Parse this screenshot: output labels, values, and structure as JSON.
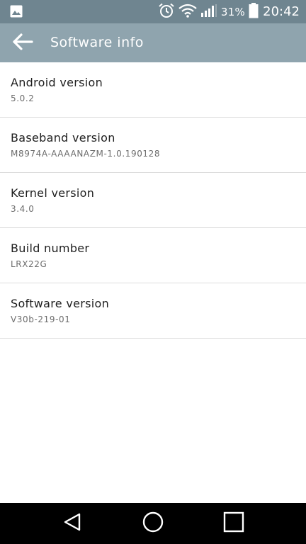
{
  "status_bar": {
    "battery_percent": "31%",
    "time": "20:42",
    "icons": [
      "image-icon",
      "alarm-icon",
      "wifi-icon",
      "signal-icon",
      "battery-icon"
    ]
  },
  "toolbar": {
    "title": "Software info",
    "back_icon": "back-arrow-icon"
  },
  "items": [
    {
      "title": "Android version",
      "summary": "5.0.2"
    },
    {
      "title": "Baseband version",
      "summary": "M8974A-AAAANAZM-1.0.190128"
    },
    {
      "title": "Kernel version",
      "summary": "3.4.0"
    },
    {
      "title": "Build number",
      "summary": "LRX22G"
    },
    {
      "title": "Software version",
      "summary": "V30b-219-01"
    }
  ],
  "nav_bar": {
    "icons": [
      "back-triangle-icon",
      "home-circle-icon",
      "recents-square-icon"
    ]
  },
  "colors": {
    "status_bar": "#6f8590",
    "toolbar": "#8fa4ae",
    "divider": "#dcdcdc",
    "nav_bar": "#000000"
  }
}
